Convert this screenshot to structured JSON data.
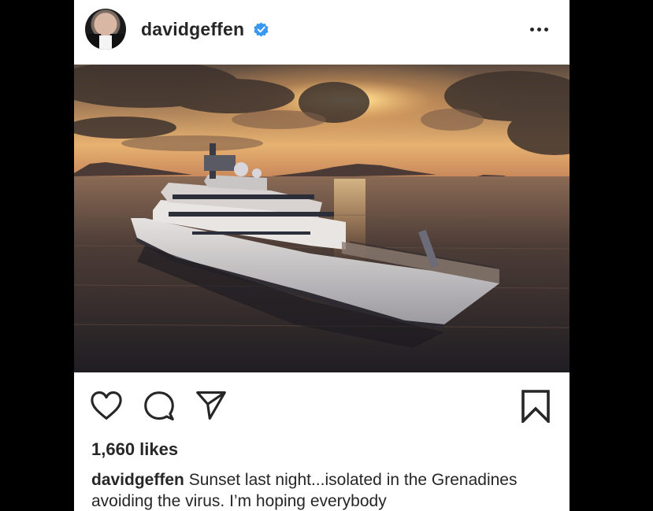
{
  "post": {
    "username": "davidgeffen",
    "verified": true,
    "avatar_icon": "profile-photo",
    "more_icon": "more-options-icon",
    "image_description_icon": "yacht-sunset-photo",
    "likes_text": "1,660 likes",
    "caption_username": "davidgeffen",
    "caption_text": "Sunset last night...isolated in the Grenadines avoiding the virus.  I’m hoping everybody"
  },
  "actions": {
    "like_icon": "heart-icon",
    "comment_icon": "comment-icon",
    "share_icon": "share-icon",
    "save_icon": "bookmark-icon"
  },
  "colors": {
    "text": "#262626",
    "verified_blue": "#3897f0",
    "background": "#000000",
    "card": "#ffffff"
  }
}
